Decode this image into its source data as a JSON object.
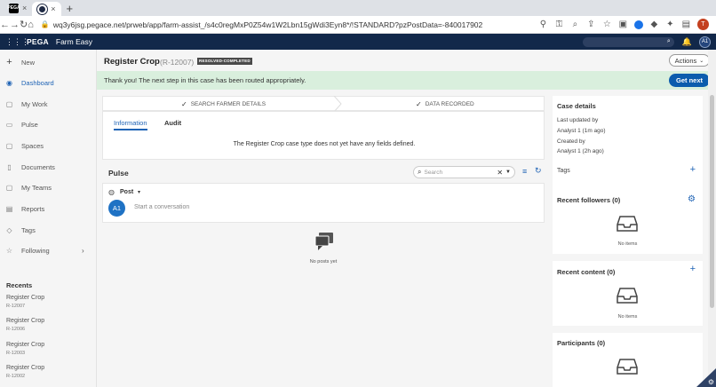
{
  "browser": {
    "tab_close": "×",
    "new_tab": "+",
    "url": "wq3y6jsg.pegace.net/prweb/app/farm-assist_/s4c0regMxP0Z54w1W2Lbn15gWdi3Eyn8*/!STANDARD?pzPostData=-840017902",
    "profile_initial": "T",
    "favicon_text": "PEGA"
  },
  "header": {
    "brand": "PEGA",
    "app_name": "Farm Easy",
    "avatar": "A1"
  },
  "sidebar": {
    "items": [
      {
        "label": "New",
        "icon": "plus-icon"
      },
      {
        "label": "Dashboard",
        "icon": "dashboard-icon"
      },
      {
        "label": "My Work",
        "icon": "work-icon"
      },
      {
        "label": "Pulse",
        "icon": "pulse-icon"
      },
      {
        "label": "Spaces",
        "icon": "spaces-icon"
      },
      {
        "label": "Documents",
        "icon": "documents-icon"
      },
      {
        "label": "My Teams",
        "icon": "teams-icon"
      },
      {
        "label": "Reports",
        "icon": "reports-icon"
      },
      {
        "label": "Tags",
        "icon": "tag-icon"
      },
      {
        "label": "Following",
        "icon": "star-icon"
      }
    ],
    "recents_title": "Recents",
    "recents": [
      {
        "title": "Register Crop",
        "id": "R-12007"
      },
      {
        "title": "Register Crop",
        "id": "R-12006"
      },
      {
        "title": "Register Crop",
        "id": "R-12003"
      },
      {
        "title": "Register Crop",
        "id": "R-12002"
      }
    ]
  },
  "case": {
    "title": "Register Crop",
    "id": "(R-12007)",
    "status": "RESOLVED-COMPLETED",
    "actions_label": "Actions",
    "banner_message": "Thank you! The next step in this case has been routed appropriately.",
    "get_next_label": "Get next",
    "stages": [
      "SEARCH FARMER DETAILS",
      "DATA RECORDED"
    ],
    "tabs": [
      "Information",
      "Audit"
    ],
    "no_fields_message": "The Register Crop case type does not yet have any fields defined."
  },
  "pulse": {
    "title": "Pulse",
    "search_placeholder": "Search",
    "post_label": "Post",
    "avatar": "A1",
    "conversation_placeholder": "Start a conversation",
    "no_posts": "No posts yet"
  },
  "right_panel": {
    "case_details_title": "Case details",
    "last_updated_label": "Last updated by",
    "last_updated_value": "Analyst 1 (1m ago)",
    "created_label": "Created by",
    "created_value": "Analyst 1 (2h ago)",
    "tags_title": "Tags",
    "recent_followers_title": "Recent followers (0)",
    "recent_content_title": "Recent content (0)",
    "participants_title": "Participants (0)",
    "no_items": "No items"
  }
}
